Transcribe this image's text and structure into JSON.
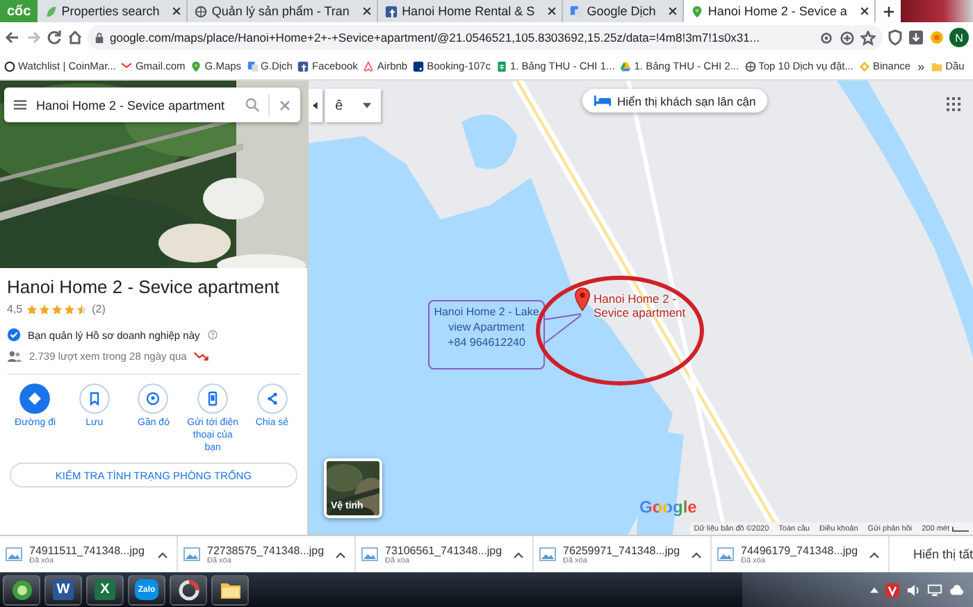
{
  "browser": {
    "logo_text": "cốc",
    "tabs": [
      {
        "title": "Properties search",
        "kind": "leaf",
        "selected": false
      },
      {
        "title": "Quản lý sản phẩm - Tran",
        "kind": "globe",
        "selected": false
      },
      {
        "title": "Hanoi Home Rental & S",
        "kind": "facebook",
        "selected": false
      },
      {
        "title": "Google Dịch",
        "kind": "translate",
        "selected": false
      },
      {
        "title": "Hanoi Home 2 - Sevice a",
        "kind": "pin",
        "selected": true
      }
    ],
    "url": "google.com/maps/place/Hanoi+Home+2+-+Sevice+apartment/@21.0546521,105.8303692,15.25z/data=!4m8!3m7!1s0x31...",
    "profile_initial": "N",
    "bookmarks": [
      {
        "label": "Watchlist | CoinMar...",
        "kind": "coin"
      },
      {
        "label": "Gmail.com",
        "kind": "gmail"
      },
      {
        "label": "G.Maps",
        "kind": "pin"
      },
      {
        "label": "G.Dịch",
        "kind": "translate"
      },
      {
        "label": "Facebook",
        "kind": "facebook"
      },
      {
        "label": "Airbnb",
        "kind": "airbnb"
      },
      {
        "label": "Booking-107c",
        "kind": "booking"
      },
      {
        "label": "1. Bảng THU - CHI 1...",
        "kind": "sheet"
      },
      {
        "label": "1. Bảng THU - CHI 2...",
        "kind": "drive"
      },
      {
        "label": "Top 10 Dịch vụ đặt...",
        "kind": "globe"
      },
      {
        "label": "Binance",
        "kind": "binance"
      }
    ],
    "more_bookmarks": "»",
    "folder": {
      "label": "Dầu",
      "kind": "folder"
    }
  },
  "place": {
    "search_value": "Hanoi Home 2 - Sevice apartment",
    "title": "Hanoi Home 2 - Sevice apartment",
    "rating": "4,5",
    "stars": 4.5,
    "review_count": "(2)",
    "owner_note": "Bạn quản lý Hồ sơ doanh nghiệp này",
    "views": "2.739 lượt xem trong 28 ngày qua",
    "actions": [
      {
        "label": "Đường đi",
        "kind": "directions"
      },
      {
        "label": "Lưu",
        "kind": "save"
      },
      {
        "label": "Gần đó",
        "kind": "nearby"
      },
      {
        "label": "Gửi tới điện thoại của bạn",
        "kind": "phone"
      },
      {
        "label": "Chia sẻ",
        "kind": "share"
      }
    ],
    "availability_button": "KIỂM TRA TÌNH TRẠNG PHÒNG TRỐNG"
  },
  "map": {
    "input_method": "ê",
    "hotels_button": "Hiển thị khách sạn lân cận",
    "pin_label": "Hanoi Home 2 - Sevice apartment",
    "note": "Hanoi Home 2 - Lake\nview Apartment\n+84 964612240",
    "satellite_label": "Vệ tinh",
    "logo": "Google",
    "footer": [
      "Dữ liệu bản đồ ©2020",
      "Toàn cầu",
      "Điều khoản",
      "Gửi phản hồi"
    ],
    "scale": "200 mét"
  },
  "downloads": {
    "items": [
      {
        "name": "74911511_741348...jpg",
        "status": "Đã xóa"
      },
      {
        "name": "72738575_741348...jpg",
        "status": "Đã xóa"
      },
      {
        "name": "73106561_741348...jpg",
        "status": "Đã xóa"
      },
      {
        "name": "76259971_741348...jpg",
        "status": "Đã xóa"
      },
      {
        "name": "74496179_741348...jpg",
        "status": "Đã xóa"
      }
    ],
    "show_all": "Hiển thị tất"
  },
  "taskbar": {
    "apps": [
      {
        "kind": "browser"
      },
      {
        "kind": "word",
        "label": "W"
      },
      {
        "kind": "excel",
        "label": "X"
      },
      {
        "kind": "zalo",
        "label": "Zalo"
      },
      {
        "kind": "media"
      },
      {
        "kind": "folder"
      }
    ]
  }
}
